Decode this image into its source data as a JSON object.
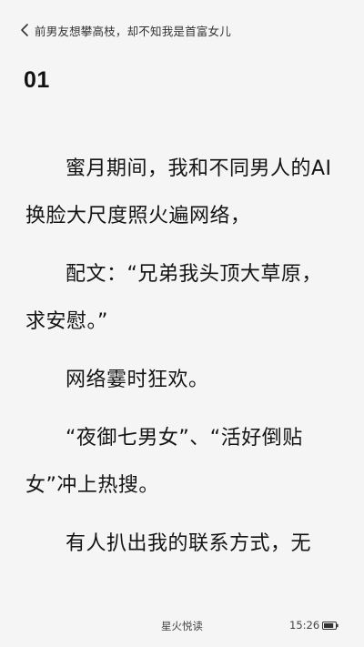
{
  "header": {
    "back_icon": "chevron-left-icon",
    "book_title": "前男友想攀高枝，却不知我是首富女儿"
  },
  "chapter": {
    "number": "01"
  },
  "paragraphs": [
    "蜜月期间，我和不同男人的AI换脸大尺度照火遍网络，",
    "配文：“兄弟我头顶大草原，求安慰。”",
    "网络霎时狂欢。",
    "“夜御七男女”、“活好倒贴女”冲上热搜。",
    "有人扒出我的联系方式，无"
  ],
  "footer": {
    "app_name": "星火悦读",
    "time": "15:26",
    "battery_icon": "battery-icon",
    "battery_level": 0.85
  },
  "colors": {
    "background": "#f5f5f5",
    "text": "#141414",
    "secondary_text": "#444444"
  }
}
